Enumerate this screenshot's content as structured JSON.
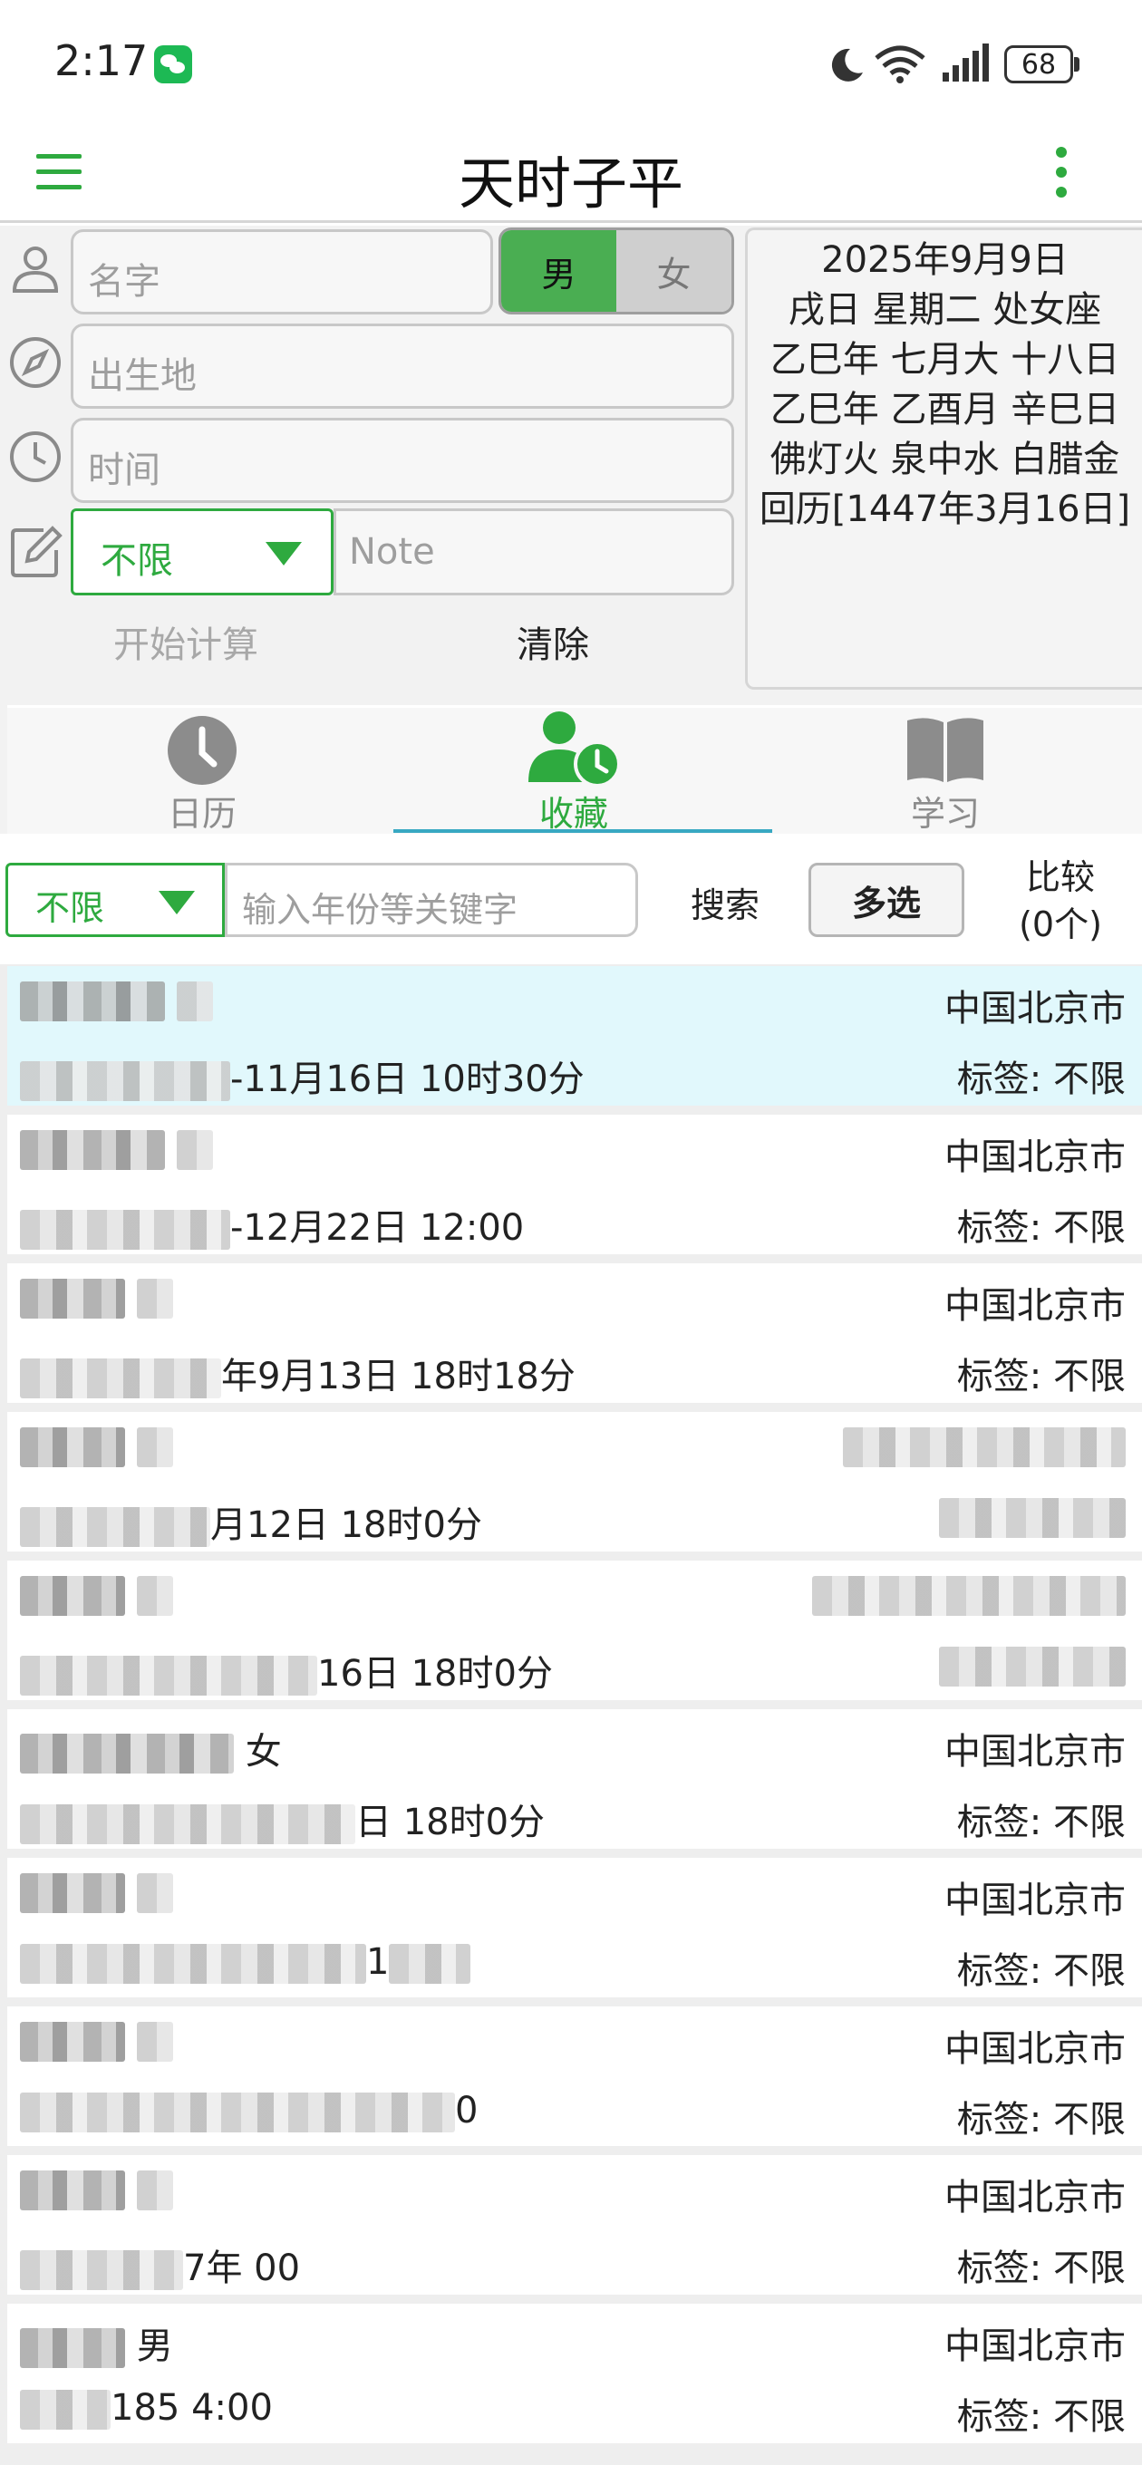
{
  "status_bar": {
    "time": "2:17",
    "battery": "68"
  },
  "title_bar": {
    "title": "天时子平"
  },
  "form": {
    "name_placeholder": "名字",
    "gender_male": "男",
    "gender_female": "女",
    "birthplace_placeholder": "出生地",
    "time_placeholder": "时间",
    "tag_value": "不限",
    "note_placeholder": "Note",
    "start_button": "开始计算",
    "clear_button": "清除"
  },
  "date_panel": {
    "lines": [
      "2025年9月9日",
      "戌日 星期二 处女座",
      "乙巳年 七月大 十八日",
      "乙巳年 乙酉月 辛巳日",
      "佛灯火 泉中水 白腊金",
      "回历[1447年3月16日]"
    ]
  },
  "tabs": [
    {
      "label": "日历",
      "active": false
    },
    {
      "label": "收藏",
      "active": true
    },
    {
      "label": "学习",
      "active": false
    }
  ],
  "search": {
    "filter_value": "不限",
    "input_placeholder": "输入年份等关键字",
    "search_button": "搜索",
    "multi_select_button": "多选",
    "compare_line1": "比较",
    "compare_line2": "(0个)"
  },
  "list": [
    {
      "name_visible": "",
      "date_visible": "-11月16日 10时30分",
      "place": "中国北京市",
      "tag": "标签: 不限",
      "selected": true
    },
    {
      "name_visible": "",
      "date_visible": "-12月22日 12:00",
      "place": "中国北京市",
      "tag": "标签: 不限",
      "selected": false
    },
    {
      "name_visible": "",
      "date_visible": "年9月13日 18时18分",
      "place": "中国北京市",
      "tag": "标签: 不限",
      "selected": false
    },
    {
      "name_visible": "",
      "date_visible": "月12日 18时0分",
      "place": "",
      "tag": "",
      "selected": false
    },
    {
      "name_visible": "",
      "date_visible": "16日 18时0分",
      "place": "",
      "tag": "",
      "selected": false
    },
    {
      "name_visible": "女",
      "date_visible": "日 18时0分",
      "place": "中国北京市",
      "tag": "标签: 不限",
      "selected": false
    },
    {
      "name_visible": "",
      "date_visible": "1",
      "place": "中国北京市",
      "tag": "标签: 不限",
      "selected": false
    },
    {
      "name_visible": "",
      "date_visible": "0",
      "place": "中国北京市",
      "tag": "标签: 不限",
      "selected": false
    },
    {
      "name_visible": "",
      "date_visible": "7年 00",
      "place": "中国北京市",
      "tag": "标签: 不限",
      "selected": false
    },
    {
      "name_visible": "男",
      "date_visible": "185 4:00",
      "place": "中国北京市",
      "tag": "标签: 不限",
      "selected": false
    }
  ],
  "colors": {
    "accent_green": "#2eaa3f",
    "tab_indicator": "#38a8c2",
    "selected_row": "#e1f8fc"
  },
  "icons": {
    "menu": "hamburger-icon",
    "more": "more-vertical-icon",
    "person": "person-icon",
    "compass": "compass-icon",
    "clock": "clock-icon",
    "edit": "edit-icon",
    "calendar_tab": "clock-tab-icon",
    "favorites_tab": "user-clock-icon",
    "study_tab": "book-icon"
  }
}
